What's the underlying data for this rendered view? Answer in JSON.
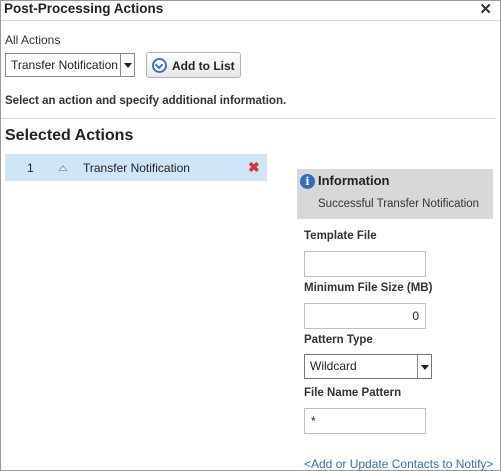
{
  "dialog": {
    "title": "Post-Processing Actions",
    "close_glyph": "✕"
  },
  "all_actions": {
    "label": "All Actions",
    "selected": "Transfer Notification",
    "add_button_label": "Add to List"
  },
  "instructions": "Select an action and specify additional information.",
  "selected_actions": {
    "heading": "Selected Actions",
    "items": [
      {
        "number": "1",
        "name": "Transfer Notification"
      }
    ]
  },
  "info_panel": {
    "title": "Information",
    "message": "Successful Transfer Notification"
  },
  "form": {
    "template_file": {
      "label": "Template File",
      "value": ""
    },
    "min_file_size": {
      "label": "Minimum File Size (MB)",
      "value": "0"
    },
    "pattern_type": {
      "label": "Pattern Type",
      "selected": "Wildcard"
    },
    "file_name_pattern": {
      "label": "File Name Pattern",
      "value": "*"
    }
  },
  "contacts_link": "<Add or Update Contacts to Notify>",
  "icons": {
    "add": "circle-chevron-down-icon",
    "delete": "red-x-icon",
    "info": "info-icon",
    "move_up": "triangle-up-icon"
  },
  "colors": {
    "selected_row": "#cfe6f9",
    "info_bg": "#d8d8d8",
    "link": "#2f6fba",
    "delete": "#dd3333"
  }
}
